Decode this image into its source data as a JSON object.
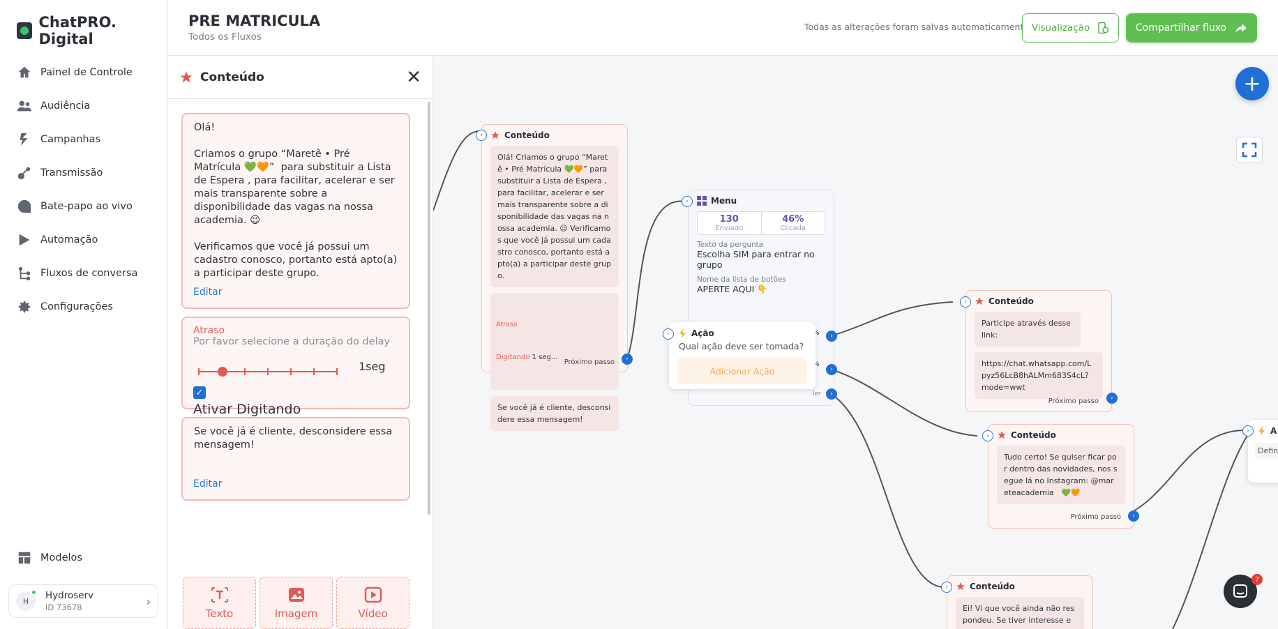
{
  "brand": {
    "name": "ChatPRO. Digital"
  },
  "nav": {
    "items": [
      {
        "label": "Painel de Controle",
        "icon": "home-icon"
      },
      {
        "label": "Audiência",
        "icon": "users-icon"
      },
      {
        "label": "Campanhas",
        "icon": "campaigns-icon"
      },
      {
        "label": "Transmissão",
        "icon": "broadcast-icon"
      },
      {
        "label": "Bate-papo ao vivo",
        "icon": "chat-icon"
      },
      {
        "label": "Automação",
        "icon": "automation-icon"
      },
      {
        "label": "Fluxos de conversa",
        "icon": "flow-icon"
      },
      {
        "label": "Configurações",
        "icon": "gear-icon"
      }
    ],
    "models": "Modelos"
  },
  "user": {
    "initial": "H",
    "name": "Hydroserv",
    "id": "ID 73678"
  },
  "header": {
    "title": "PRE MATRICULA",
    "breadcrumb": "Todos os Fluxos",
    "save_status": "Todas as alterações foram salvas automaticamente",
    "preview_label": "Visualização",
    "share_label": "Compartilhar fluxo"
  },
  "panel": {
    "title": "Conteúdo",
    "message1": "Olá!\n\nCriamos o grupo “Maretê • Pré Matrícula 💚🧡”  para substituir a Lista de Espera , para facilitar, acelerar e ser mais transparente sobre a disponibilidade das vagas na nossa academia. 😉\n\nVerificamos que você já possui um cadastro conosco, portanto está apto(a) a participar deste grupo.",
    "edit_label": "Editar",
    "delay_label": "Atraso",
    "delay_help": "Por favor selecione a duração do delay",
    "delay_value": "1seg",
    "typing_label": "Ativar Digitando",
    "message2": "Se você já é cliente, desconsidere essa mensagem!",
    "add_buttons": [
      "Texto",
      "Imagem",
      "Vídeo"
    ]
  },
  "canvas": {
    "node1": {
      "title": "Conteúdo",
      "text": "Olá! Criamos o grupo “Maretê • Pré Matrícula 💚🧡” para substituir a Lista de Espera , para facilitar, acelerar e ser mais transparente sobre a disponibilidade das vagas na nossa academia. 😉 Verificamos que você já possui um cadastro conosco, portanto está apto(a) a participar deste grupo.",
      "delay_label": "Atraso",
      "delay_text": "Digitando",
      "delay_value": "1 seg...",
      "text2": "Se você já é cliente, desconsidere essa mensagem!",
      "next": "Próximo passo"
    },
    "menu": {
      "title": "Menu",
      "sent_value": "130",
      "sent_label": "Enviado",
      "click_value": "46%",
      "click_label": "Clicada",
      "question_label": "Texto da pergunta",
      "question": "Escolha SIM para entrar no grupo",
      "list_label": "Nome da lista de botões",
      "list_value": "APERTE AQUI 👇",
      "pct1": "%",
      "pct2": "%",
      "partial": "ler"
    },
    "action": {
      "title": "Ação",
      "question": "Qual ação deve ser tomada?",
      "add_label": "Adicionar Ação"
    },
    "node2": {
      "title": "Conteúdo",
      "text": "Participe através desse link:",
      "link": "https://chat.whatsapp.com/Lpyz56LcB8hALMm683S4cL?mode=wwt",
      "next": "Próximo passo"
    },
    "node3": {
      "title": "Conteúdo",
      "text": "Tudo certo! Se quiser ficar por dentro das novidades, nos segue lá no Instagram: @mareteacademia   💚🧡",
      "next": "Próximo passo"
    },
    "node4": {
      "title": "Conteúdo",
      "text": "Ei! Vi que você ainda não respondeu. Se tiver interesse em e"
    },
    "node5": {
      "title": "A",
      "text": "Defin"
    }
  },
  "chat_badge": "7",
  "colors": {
    "accent": "#1f6fd6",
    "brand_green": "#5fbf52",
    "content_red": "#e25b55"
  }
}
